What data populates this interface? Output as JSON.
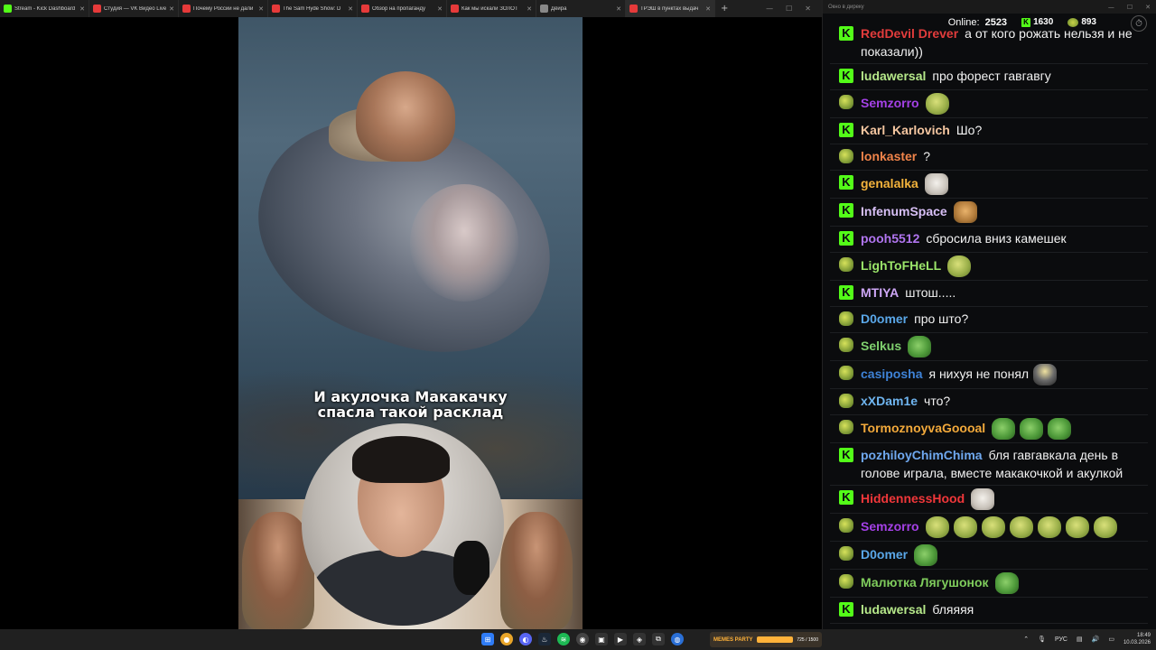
{
  "browser": {
    "tabs": [
      {
        "title": "Stream - Kick Dashboard",
        "color": "#53fc18",
        "active": false
      },
      {
        "title": "Студия — VK Видео Live",
        "color": "#e63a3a",
        "active": false
      },
      {
        "title": "Почему России не дали",
        "color": "#e63a3a",
        "active": false
      },
      {
        "title": "The Sam Hyde Show: D",
        "color": "#e63a3a",
        "active": false
      },
      {
        "title": "Обзор на пропаганду",
        "color": "#e63a3a",
        "active": false
      },
      {
        "title": "Как мы искали ЗОЛОТ",
        "color": "#e63a3a",
        "active": false
      },
      {
        "title": "Дёйра",
        "color": "#888888",
        "active": false
      },
      {
        "title": "ТРЭШ в пунктах выдач",
        "color": "#e63a3a",
        "active": true
      }
    ],
    "new_tab": "+"
  },
  "video": {
    "caption_line1": "И акулочка Макакачку",
    "caption_line2": "спасла такой расклад"
  },
  "chat": {
    "window_title": "Окно в диреку",
    "online_label": "Online:",
    "online_count": "2523",
    "kick_count": "1630",
    "gift_count": "893",
    "settings_icon": "⏱",
    "messages": [
      {
        "badge": "k",
        "user": "RedDevil Drever",
        "color": "#e23c3c",
        "text": "а от кого рожать нельзя и не показали))",
        "emotes": []
      },
      {
        "badge": "k",
        "user": "ludawersal",
        "color": "#b6e88a",
        "text": "про форест гавгавгу",
        "emotes": []
      },
      {
        "badge": "g",
        "user": "Semzorro",
        "color": "#a441e6",
        "text": "",
        "emotes": [
          "pepe"
        ]
      },
      {
        "badge": "k",
        "user": "Karl_Karlovich",
        "color": "#f5c6a0",
        "text": "Шо?",
        "emotes": []
      },
      {
        "badge": "g",
        "user": "lonkaster",
        "color": "#f0844a",
        "text": "?",
        "emotes": []
      },
      {
        "badge": "k",
        "user": "genalalka",
        "color": "#f4b33c",
        "text": "",
        "emotes": [
          "cat"
        ]
      },
      {
        "badge": "k",
        "user": "InfenumSpace",
        "color": "#d7bff5",
        "text": "",
        "emotes": [
          "lion"
        ]
      },
      {
        "badge": "k",
        "user": "pooh5512",
        "color": "#b175f0",
        "text": "сбросила вниз камешек",
        "emotes": []
      },
      {
        "badge": "g",
        "user": "LighToFHeLL",
        "color": "#9be56a",
        "text": "",
        "emotes": [
          "pepe"
        ]
      },
      {
        "badge": "k",
        "user": "MTIYA",
        "color": "#cda6f5",
        "text": "штош.....",
        "emotes": []
      },
      {
        "badge": "g",
        "user": "D0omer",
        "color": "#5aa7e8",
        "text": "про што?",
        "emotes": []
      },
      {
        "badge": "g",
        "user": "Selkus",
        "color": "#7fd06e",
        "text": "",
        "emotes": [
          "frog"
        ]
      },
      {
        "badge": "g",
        "user": "casiposha",
        "color": "#3e82d6",
        "text": "я нихуя не понял",
        "emotes": [
          "figure"
        ]
      },
      {
        "badge": "g",
        "user": "xXDam1e",
        "color": "#6fb5f0",
        "text": "что?",
        "emotes": []
      },
      {
        "badge": "g",
        "user": "TormoznoyvaGoooal",
        "color": "#f2a93b",
        "text": "",
        "emotes": [
          "frog",
          "frog",
          "frog"
        ]
      },
      {
        "badge": "k",
        "user": "pozhiloyChimChima",
        "color": "#6fa8ef",
        "text": "бля гавгавкала день в голове играла, вместе макакочкой и акулкой",
        "emotes": []
      },
      {
        "badge": "k",
        "user": "HiddennessHood",
        "color": "#f0373a",
        "text": "",
        "emotes": [
          "cat"
        ]
      },
      {
        "badge": "g",
        "user": "Semzorro",
        "color": "#a441e6",
        "text": "",
        "emotes": [
          "pepe",
          "pepe",
          "pepe",
          "pepe",
          "pepe",
          "pepe",
          "pepe"
        ]
      },
      {
        "badge": "g",
        "user": "D0omer",
        "color": "#5aa7e8",
        "text": "",
        "emotes": [
          "frog"
        ]
      },
      {
        "badge": "g",
        "user": "Малютка Лягушонок",
        "color": "#7fcc5c",
        "text": "",
        "emotes": [
          "frog"
        ]
      },
      {
        "badge": "k",
        "user": "ludawersal",
        "color": "#b6e88a",
        "text": "бляяяя",
        "emotes": []
      }
    ]
  },
  "taskbar": {
    "widget_label": "MEMES PARTY",
    "widget_value": "725 / 1500",
    "lang": "РУС",
    "time": "18:49",
    "date": "10.03.2026"
  }
}
